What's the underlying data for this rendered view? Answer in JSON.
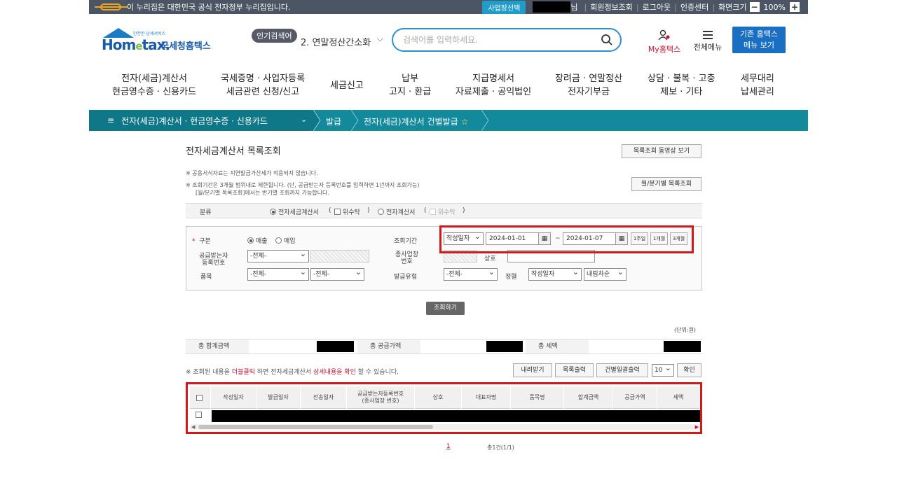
{
  "govbar": {
    "notice": "이 누리집은 대한민국 공식 전자정부 누리집입니다.",
    "biz_select": "사업장선택",
    "user_suffix": "님",
    "links": [
      "회원정보조회",
      "로그아웃",
      "인증센터",
      "화면크기"
    ],
    "zoom": "100%",
    "zoom_minus": "−",
    "zoom_plus": "+"
  },
  "header": {
    "logo_small": "안전한 납세서비스",
    "logo_home": "Hom",
    "logo_e": "e",
    "logo_tax": "tax.",
    "logo_nts": "국세청홈택스",
    "popular_tag": "인기검색어",
    "popular_rank": "2.  연말정산간소화",
    "search_placeholder": "검색어를 입력하세요.",
    "myhome": "My홈택스",
    "allmenu": "전체메뉴",
    "classic_line1": "기존 홈택스",
    "classic_line2": "메뉴 보기"
  },
  "mainnav": [
    {
      "l1": "전자(세금)계산서",
      "l2": "현금영수증 · 신용카드"
    },
    {
      "l1": "국세증명 · 사업자등록",
      "l2": "세금관련 신청/신고"
    },
    {
      "l1": "세금신고",
      "l2": ""
    },
    {
      "l1": "납부",
      "l2": "고지 · 환급"
    },
    {
      "l1": "지급명세서",
      "l2": "자료제출 · 공익법인"
    },
    {
      "l1": "장려금 · 연말정산",
      "l2": "전자기부금"
    },
    {
      "l1": "상담 · 불복 · 고충",
      "l2": "제보 · 기타"
    },
    {
      "l1": "세무대리",
      "l2": "납세관리"
    }
  ],
  "breadcrumb": {
    "menu_icon": "≡",
    "seg1": "전자(세금)계산서 · 현금영수증 · 신용카드",
    "chev": "⌄",
    "seg2": "발급",
    "seg3": "전자(세금)계산서 건별발급",
    "star": "☆"
  },
  "content": {
    "title": "전자세금계산서 목록조회",
    "video_btn": "목록조회 동영상 보기",
    "monthly_btn": "월/분기별 목록조회",
    "notes": [
      "※ 공용서식자료는 지연발급가산세가 적용되지 않습니다.",
      "※ 조회기간은 3개월 범위내로 제한됩니다. (단, 공급받는자 등록번호를 입력하면 1년까지 조회가능)",
      "[월/분기별 목록조회]에서는 반기별 조회까지 가능합니다."
    ],
    "kind": {
      "label": "분류",
      "opt1": "전자세금계산서",
      "opt1_sub": "위수탁",
      "opt2": "전자계산서",
      "opt2_sub": "위수탁",
      "paren_open": "(",
      "paren_close": ")"
    },
    "search": {
      "type_label": "구분",
      "required_mark": "*",
      "sales": "매출",
      "purchase": "매입",
      "period_label": "조회기간",
      "date_type": "작성일자",
      "date_from": "2024-01-01",
      "date_to": "2024-01-07",
      "tilde": "~",
      "cal_icon": "▦",
      "p1": "1주일",
      "p2": "1개월",
      "p3": "3개월",
      "receiver_label_1": "공급받는자",
      "receiver_label_2": "등록번호",
      "receiver_select": "-전체-",
      "branch_label_1": "종사업장",
      "branch_label_2": "번호",
      "company_label": "상호",
      "item_label": "품목",
      "item_select_1": "-전체-",
      "item_select_2": "-전체-",
      "issue_type_label": "발급유형",
      "issue_type_select": "-전체-",
      "sort_label": "정렬",
      "sort_field": "작성일자",
      "sort_order": "내림차순"
    },
    "query_btn": "조회하기",
    "unit": "(단위:원)",
    "sums": {
      "total": "총 합계금액",
      "supply": "총 공급가액",
      "tax": "총 세액"
    },
    "help": {
      "pre": "※ 조회된 내용을 ",
      "hl": "더블클릭",
      "mid": " 하면 전자세금계산서 ",
      "bl": "상세내용을 확인",
      "post": " 할 수 있습니다."
    },
    "actions": {
      "download": "내려받기",
      "list_print": "목록출력",
      "batch_print": "건별일괄출력",
      "page_size": "10",
      "confirm": "확인"
    },
    "columns": [
      "작성일자",
      "발급일자",
      "전송일자",
      "공급받는자등록번호\n(종사업장 번호)",
      "상호",
      "대표자명",
      "품목명",
      "합계금액",
      "공급가액",
      "세액"
    ],
    "scroll_left": "◀",
    "scroll_right": "▶",
    "page": "1",
    "total_count": "총1건(1/1)"
  }
}
